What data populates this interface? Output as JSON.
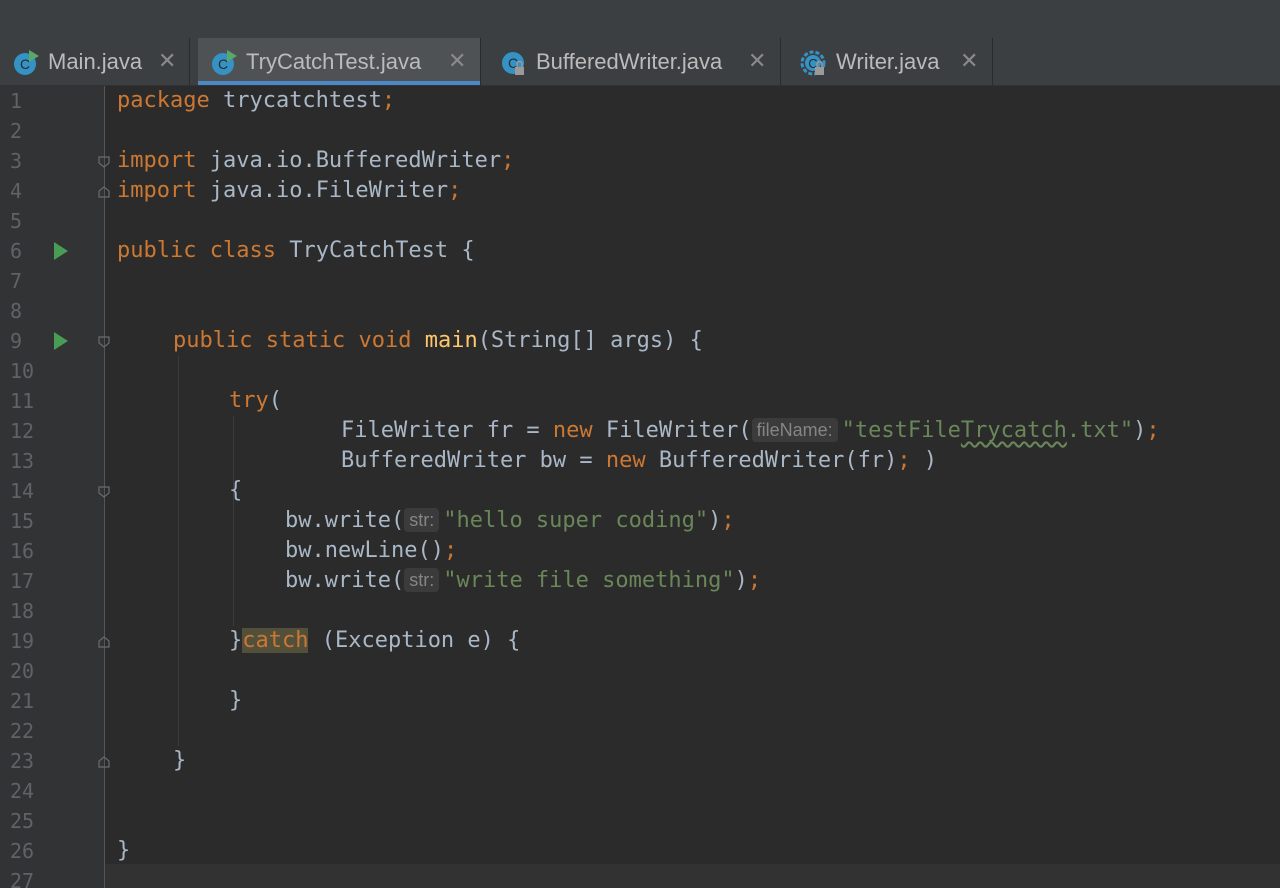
{
  "tabs": [
    {
      "label": "Main.java",
      "active": false,
      "icon": "class-run-icon"
    },
    {
      "label": "TryCatchTest.java",
      "active": true,
      "icon": "class-run-icon"
    },
    {
      "label": "BufferedWriter.java",
      "active": false,
      "icon": "class-locked-icon"
    },
    {
      "label": "Writer.java",
      "active": false,
      "icon": "abstract-class-locked-icon"
    }
  ],
  "close_glyph": "✕",
  "line_numbers": [
    "1",
    "2",
    "3",
    "4",
    "5",
    "6",
    "7",
    "8",
    "9",
    "10",
    "11",
    "12",
    "13",
    "14",
    "15",
    "16",
    "17",
    "18",
    "19",
    "20",
    "21",
    "22",
    "23",
    "24",
    "25",
    "26",
    "27"
  ],
  "code": {
    "l1": {
      "kw": "package",
      "rest": " trycatchtest",
      "semi": ";"
    },
    "l3": {
      "kw": "import",
      "rest": " java.io.BufferedWriter",
      "semi": ";"
    },
    "l4": {
      "kw": "import",
      "rest": " java.io.FileWriter",
      "semi": ";"
    },
    "l6": {
      "kw1": "public",
      "kw2": "class",
      "rest": " TryCatchTest {"
    },
    "l9": {
      "kw1": "public",
      "kw2": "static",
      "kw3": "void",
      "fn": "main",
      "rest": "(String[] args) {"
    },
    "l11": {
      "kw": "try",
      "rest": "("
    },
    "l12": {
      "a": "FileWriter fr = ",
      "kw": "new",
      "b": " FileWriter(",
      "hint": "fileName:",
      "str1": "\"testFile",
      "strwavy": "Trycatch",
      "str2": ".txt\"",
      "c": ")",
      "semi": ";"
    },
    "l13": {
      "a": "BufferedWriter bw = ",
      "kw": "new",
      "b": " BufferedWriter(fr)",
      "semi": ";",
      "c": " )"
    },
    "l14": {
      "text": "{"
    },
    "l15": {
      "a": "bw.write(",
      "hint": "str:",
      "str": "\"hello super coding\"",
      "b": ")",
      "semi": ";"
    },
    "l16": {
      "a": "bw.newLine()",
      "semi": ";"
    },
    "l17": {
      "a": "bw.write(",
      "hint": "str:",
      "str": "\"write file something\"",
      "b": ")",
      "semi": ";"
    },
    "l19": {
      "a": "}",
      "kw": "catch",
      "b": " (Exception e) {"
    },
    "l21": {
      "text": "}"
    },
    "l23": {
      "text": "}"
    },
    "l26": {
      "text": "}"
    }
  },
  "colors": {
    "keyword": "#cc7832",
    "string": "#6a8759",
    "function": "#ffc66d",
    "text": "#a9b7c6",
    "active_tab_underline": "#4a88c7",
    "run_marker": "#499c54"
  }
}
